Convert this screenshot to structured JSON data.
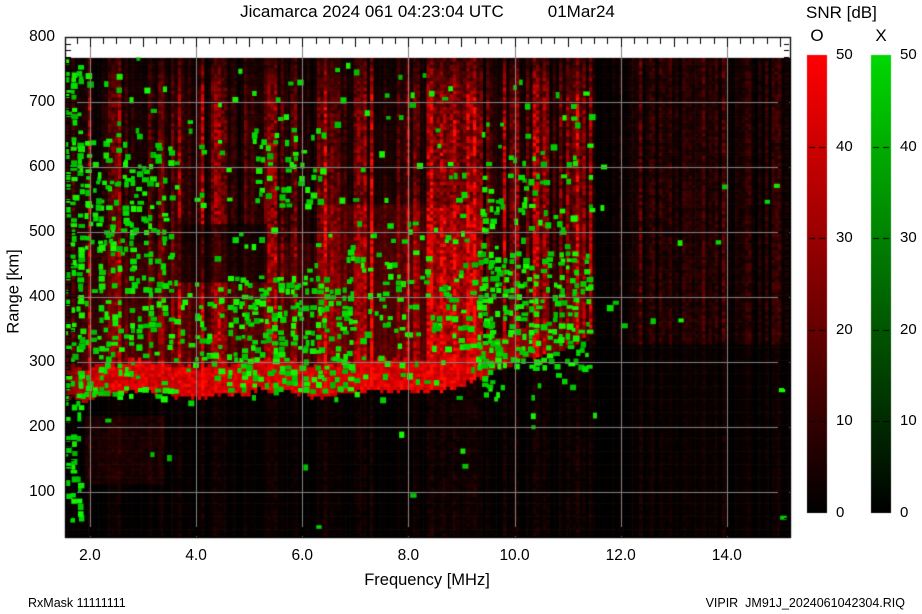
{
  "header": {
    "title_left": "Jicamarca 2024 061 04:23:04 UTC",
    "title_right": "01Mar24"
  },
  "footer": {
    "rx_mask": "RxMask 11111111",
    "file": "VIPIR  JM91J_2024061042304.RIQ"
  },
  "colorbar": {
    "title": "SNR [dB]",
    "o_label": "O",
    "x_label": "X",
    "min": 0,
    "max": 50,
    "tick_values": [
      0,
      10,
      20,
      30,
      40,
      50
    ],
    "tick_labels": [
      "0",
      "10",
      "20",
      "30",
      "40",
      "50"
    ],
    "o_top_color": "#ff0000",
    "x_top_color": "#00d800",
    "bottom_color": "#000000"
  },
  "chart_data": {
    "type": "heatmap",
    "title": "Jicamarca 2024 061 04:23:04 UTC  01Mar24",
    "xlabel": "Frequency [MHz]",
    "ylabel": "Range [km]",
    "xlim": [
      1.53,
      15.19
    ],
    "ylim": [
      31,
      800
    ],
    "data_top_km": 768,
    "xticks": [
      2,
      4,
      6,
      8,
      10,
      12,
      14
    ],
    "xtick_labels": [
      "2.0",
      "4.0",
      "6.0",
      "8.0",
      "10.0",
      "12.0",
      "14.0"
    ],
    "yticks": [
      100,
      200,
      300,
      400,
      500,
      600,
      700,
      800
    ],
    "ytick_labels": [
      "100",
      "200",
      "300",
      "400",
      "500",
      "600",
      "700",
      "800"
    ],
    "minor_xtick_step": 0.25,
    "minor_ytick_step": 10,
    "grid": true,
    "grid_color": "#828282",
    "background_color": "#000000",
    "series": [
      {
        "name": "O-mode",
        "color": "#ff0000"
      },
      {
        "name": "X-mode",
        "color": "#00cc00"
      }
    ],
    "snr_range_db": [
      0,
      50
    ],
    "seed": 42,
    "echo": {
      "bottom_km_points": [
        [
          1.53,
          246
        ],
        [
          4,
          248
        ],
        [
          8,
          252
        ],
        [
          9,
          264
        ],
        [
          9.8,
          286
        ],
        [
          10.5,
          306
        ],
        [
          11.0,
          324
        ],
        [
          11.45,
          342
        ]
      ],
      "max_f": 11.45,
      "top_km": 768,
      "bright_band_km": 48,
      "bright_amp_points": [
        [
          1.53,
          0.55
        ],
        [
          1.8,
          0.8
        ],
        [
          2.1,
          1
        ],
        [
          8.8,
          1
        ],
        [
          9.6,
          0.8
        ],
        [
          10.4,
          0.55
        ],
        [
          11.2,
          0.35
        ],
        [
          11.45,
          0.2
        ]
      ]
    },
    "rfi_bands": [
      [
        4.3,
        4.55,
        0.35
      ],
      [
        5.3,
        5.5,
        0.3
      ],
      [
        6.25,
        6.6,
        0.4
      ],
      [
        7.0,
        7.2,
        0.3
      ],
      [
        8.3,
        9.35,
        0.55
      ],
      [
        9.85,
        10.05,
        0.35
      ],
      [
        10.3,
        10.55,
        0.4
      ],
      [
        11.05,
        11.3,
        0.35
      ],
      [
        12.15,
        12.35,
        0.22
      ],
      [
        13.2,
        13.55,
        0.25
      ],
      [
        14.3,
        14.45,
        0.15
      ]
    ],
    "red_fill_regions": [
      [
        6.3,
        9.4,
        260,
        540,
        0.2
      ],
      [
        1.8,
        6.3,
        250,
        480,
        0.12
      ]
    ],
    "dark_patches": [
      [
        3.6,
        5.3,
        420,
        510,
        0.4
      ]
    ],
    "red_patches": [
      [
        1.9,
        3.4,
        110,
        215,
        0.13
      ]
    ],
    "green_patches": [
      [
        1.53,
        1.8,
        60,
        768,
        0.55
      ],
      [
        1.8,
        3.6,
        250,
        640,
        0.3
      ],
      [
        2.0,
        3.2,
        450,
        580,
        0.25
      ],
      [
        3.6,
        4.6,
        260,
        430,
        0.18
      ],
      [
        4.6,
        6.9,
        258,
        430,
        0.5
      ],
      [
        5.1,
        6.4,
        540,
        660,
        0.22
      ],
      [
        6.9,
        9.3,
        270,
        520,
        0.14
      ],
      [
        9.3,
        11.4,
        295,
        475,
        0.5
      ],
      [
        9.4,
        9.65,
        250,
        600,
        0.35
      ],
      [
        9.9,
        11.2,
        480,
        640,
        0.12
      ],
      [
        1.8,
        11.45,
        245,
        768,
        0.055
      ],
      [
        11.5,
        15.19,
        60,
        768,
        0.006
      ],
      [
        1.8,
        11.45,
        40,
        240,
        0.006
      ]
    ]
  }
}
